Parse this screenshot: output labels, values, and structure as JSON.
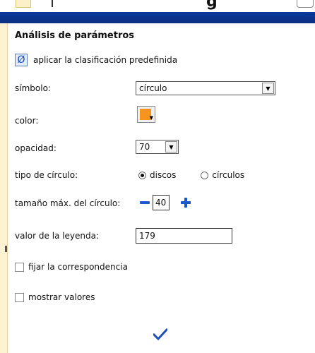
{
  "top_fragment": {
    "title_fragment": "g"
  },
  "panel": {
    "title": "Análisis de parámetros",
    "predefined_label": "aplicar la clasificación predefinida",
    "symbol": {
      "label": "símbolo:",
      "value": "círculo"
    },
    "color": {
      "label": "color:",
      "value": "#f7941d"
    },
    "opacity": {
      "label": "opacidad:",
      "value": "70"
    },
    "circle_type": {
      "label": "tipo de círculo:",
      "options": [
        "discos",
        "círculos"
      ],
      "selected": "discos"
    },
    "max_size": {
      "label": "tamaño máx. del círculo:",
      "value": "40"
    },
    "legend_value": {
      "label": "valor de la leyenda:",
      "value": "179"
    },
    "fix_mapping": {
      "label": "fijar la correspondencia",
      "checked": false
    },
    "show_values": {
      "label": "mostrar valores",
      "checked": false
    }
  },
  "icons": {
    "predefined": "empty-set-icon",
    "ok": "checkmark-icon",
    "decrease": "minus-icon",
    "increase": "plus-icon"
  }
}
